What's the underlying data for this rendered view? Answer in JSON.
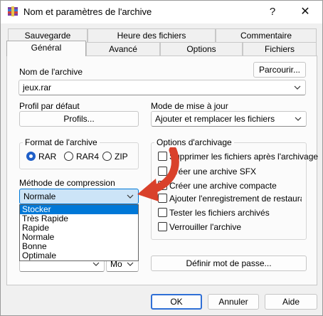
{
  "window": {
    "title": "Nom et paramètres de l'archive",
    "help_glyph": "?",
    "close_glyph": "✕"
  },
  "tabs": {
    "row1": [
      "Sauvegarde",
      "Heure des fichiers",
      "Commentaire"
    ],
    "row2": [
      "Général",
      "Avancé",
      "Options",
      "Fichiers"
    ],
    "selected": "Général"
  },
  "archive_name": {
    "label": "Nom de l'archive",
    "value": "jeux.rar",
    "browse_label": "Parcourir..."
  },
  "profile": {
    "label": "Profil par défaut",
    "button_label": "Profils..."
  },
  "update_mode": {
    "label": "Mode de mise à jour",
    "value": "Ajouter et remplacer les fichiers"
  },
  "archive_format": {
    "title": "Format de l'archive",
    "options": [
      "RAR",
      "RAR4",
      "ZIP"
    ],
    "selected": "RAR"
  },
  "archiving_options": {
    "title": "Options d'archivage",
    "items": [
      "Supprimer les fichiers après l'archivage",
      "Créer une archive SFX",
      "Créer une archive compacte",
      "Ajouter l'enregistrement de restauration",
      "Tester les fichiers archivés",
      "Verrouiller l'archive"
    ]
  },
  "compression": {
    "label": "Méthode de compression",
    "value": "Normale",
    "options": [
      "Stocker",
      "Très Rapide",
      "Rapide",
      "Normale",
      "Bonne",
      "Optimale"
    ],
    "highlighted": "Stocker"
  },
  "split_unit": {
    "value": "Mo"
  },
  "password_button": "Définir mot de passe...",
  "footer": {
    "ok": "OK",
    "cancel": "Annuler",
    "help": "Aide"
  },
  "colors": {
    "accent": "#0078d7",
    "red_arrow": "#d9412b"
  }
}
